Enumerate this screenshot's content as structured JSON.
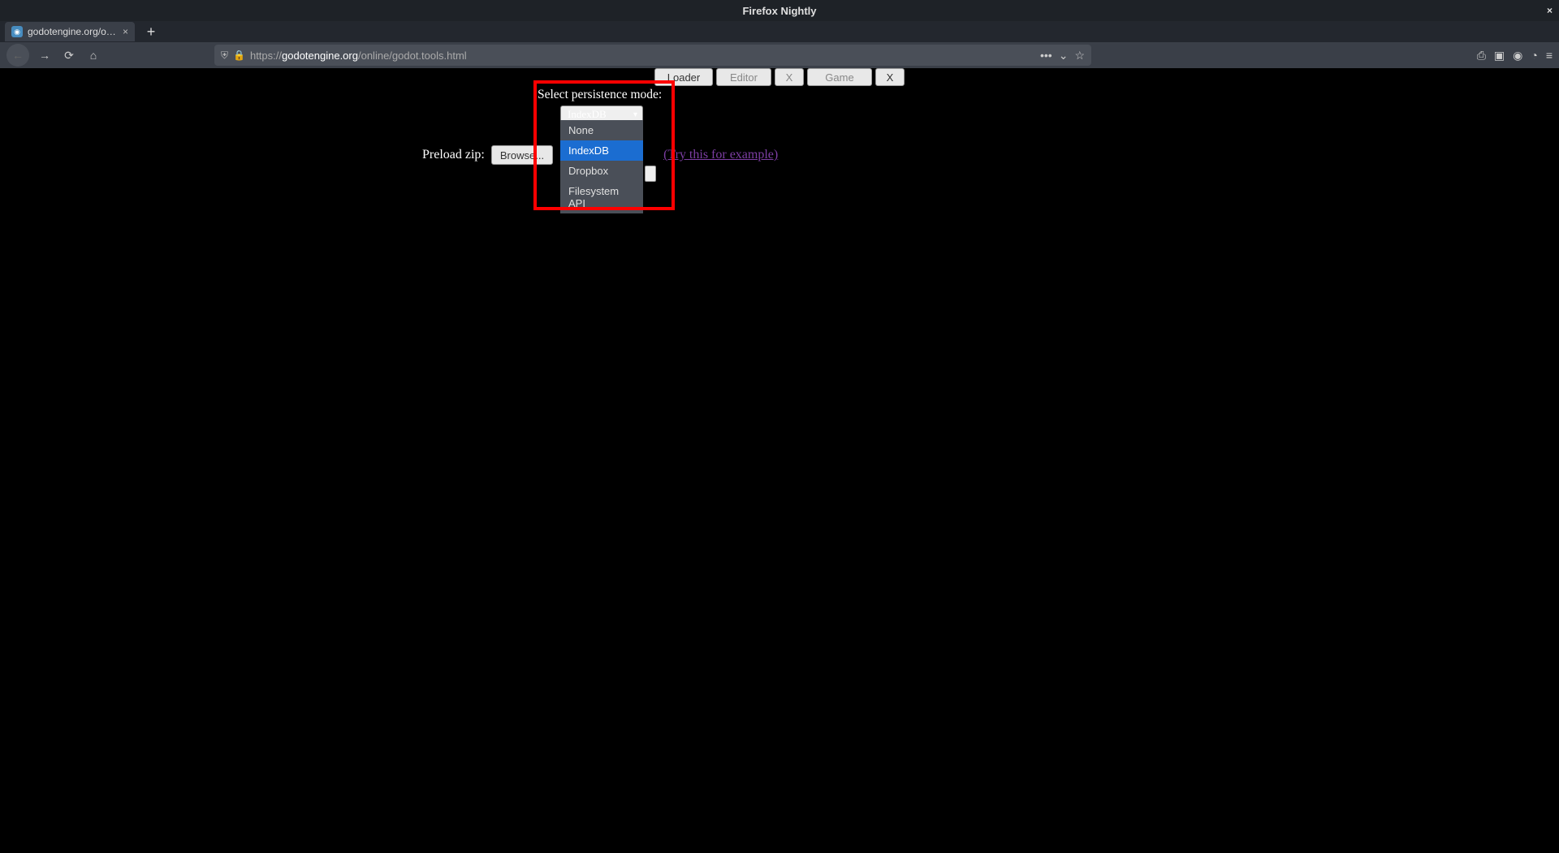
{
  "window": {
    "title": "Firefox Nightly",
    "close": "×"
  },
  "tab": {
    "label": "godotengine.org/online/g",
    "close": "×"
  },
  "newtab": "+",
  "nav": {
    "back": "←",
    "forward": "→",
    "reload": "⟳",
    "home": "⌂"
  },
  "url": {
    "shield": "⛨",
    "lock": "🔒",
    "protocol": "https://",
    "domain": "godotengine.org",
    "path": "/online/godot.tools.html",
    "more": "•••",
    "pocket": "⌄",
    "star": "☆"
  },
  "righticons": {
    "library": "⎙",
    "sidebar": "▣",
    "account": "◉",
    "stopwatch": "◔",
    "ext": "≡"
  },
  "topbuttons": {
    "loader": "Loader",
    "editor": "Editor",
    "x1": "X",
    "game": "Game",
    "x2": "X"
  },
  "persistence": {
    "label": "Select persistence mode:",
    "selected": "IndexDB",
    "options": [
      "None",
      "IndexDB",
      "Dropbox",
      "Filesystem API"
    ]
  },
  "preload": {
    "label": "Preload zip:",
    "browse": "Browse...",
    "try": "(Try this for example)"
  }
}
